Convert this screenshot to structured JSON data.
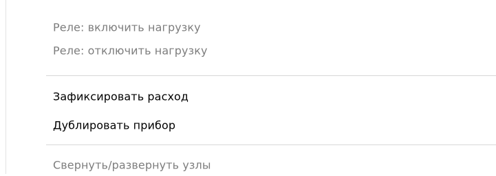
{
  "context_menu": {
    "items": [
      {
        "label": "Реле: включить нагрузку",
        "enabled": false
      },
      {
        "label": "Реле: отключить нагрузку",
        "enabled": false
      },
      {
        "label": "Зафиксировать расход",
        "enabled": true
      },
      {
        "label": "Дублировать прибор",
        "enabled": true
      },
      {
        "label": "Свернуть/развернуть узлы",
        "enabled": false
      }
    ]
  },
  "colors": {
    "disabled_text": "#7d7d7d",
    "enabled_text": "#000000",
    "separator": "#d7d7d7",
    "background": "#ffffff"
  }
}
